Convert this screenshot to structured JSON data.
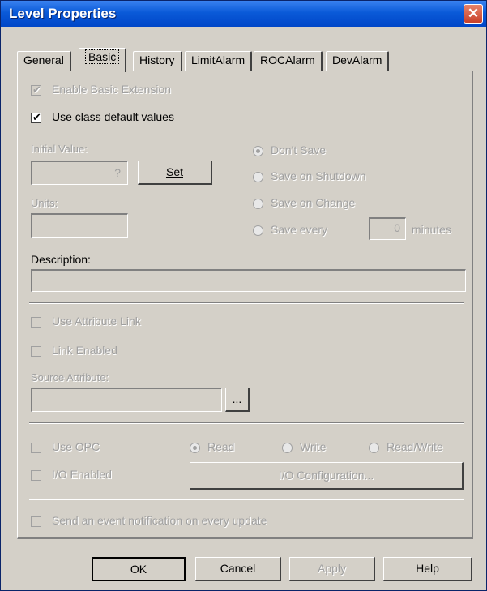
{
  "window": {
    "title": "Level Properties",
    "close_glyph": "✕"
  },
  "tabs": [
    {
      "label": "General"
    },
    {
      "label": "Basic"
    },
    {
      "label": "History"
    },
    {
      "label": "LimitAlarm"
    },
    {
      "label": "ROCAlarm"
    },
    {
      "label": "DevAlarm"
    }
  ],
  "basic": {
    "enable_extension": {
      "label": "Enable Basic Extension",
      "checked": true,
      "enabled": false
    },
    "use_class_defaults": {
      "label": "Use class default values",
      "checked": true,
      "enabled": true
    },
    "initial_value": {
      "label": "Initial Value:",
      "value": "?",
      "set_button": "Set"
    },
    "units": {
      "label": "Units:",
      "value": ""
    },
    "save_options": [
      {
        "label": "Don't Save",
        "selected": true
      },
      {
        "label": "Save on Shutdown",
        "selected": false
      },
      {
        "label": "Save on Change",
        "selected": false
      },
      {
        "label": "Save every",
        "selected": false
      }
    ],
    "save_every_value": "0",
    "save_every_unit": "minutes",
    "description": {
      "label": "Description:",
      "value": ""
    },
    "use_attribute_link": {
      "label": "Use Attribute Link",
      "checked": false
    },
    "link_enabled": {
      "label": "Link Enabled",
      "checked": false
    },
    "source_attribute": {
      "label": "Source Attribute:",
      "value": "",
      "browse_label": "..."
    },
    "use_opc": {
      "label": "Use OPC",
      "checked": false
    },
    "io_enabled": {
      "label": "I/O Enabled",
      "checked": false
    },
    "access_modes": [
      {
        "label": "Read",
        "selected": true
      },
      {
        "label": "Write",
        "selected": false
      },
      {
        "label": "Read/Write",
        "selected": false
      }
    ],
    "io_config_button": "I/O Configuration...",
    "send_event": {
      "label": "Send an event notification on every update",
      "checked": false
    }
  },
  "footer": {
    "ok": "OK",
    "cancel": "Cancel",
    "apply": "Apply",
    "help": "Help"
  }
}
